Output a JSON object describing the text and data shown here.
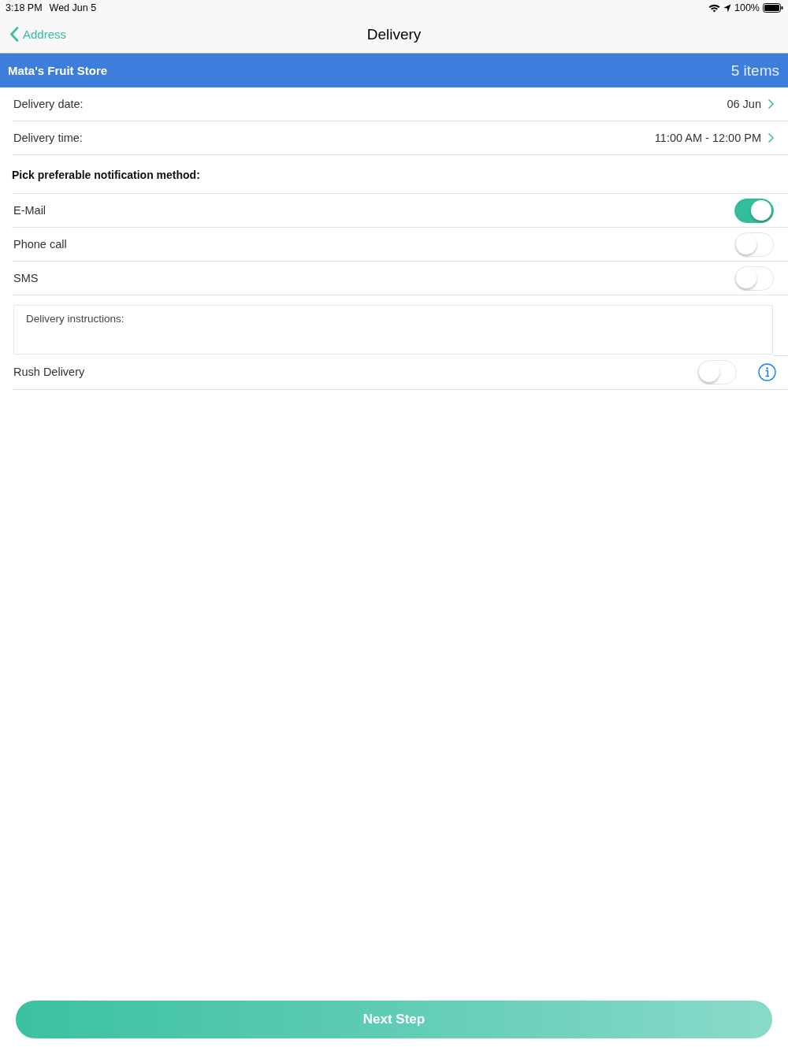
{
  "status_bar": {
    "time": "3:18 PM",
    "date": "Wed Jun 5",
    "battery": "100%"
  },
  "nav_bar": {
    "back_label": "Address",
    "title": "Delivery"
  },
  "store_header": {
    "name": "Mata's Fruit Store",
    "item_count": "5 items"
  },
  "schedule_rows": [
    {
      "label": "Delivery date:",
      "value": "06 Jun"
    },
    {
      "label": "Delivery time:",
      "value": "11:00 AM - 12:00 PM"
    }
  ],
  "notification": {
    "heading": "Pick preferable notification method:",
    "options": [
      {
        "label": "E-Mail",
        "on": true
      },
      {
        "label": "Phone call",
        "on": false
      },
      {
        "label": "SMS",
        "on": false
      }
    ]
  },
  "instructions": {
    "placeholder": "Delivery instructions:"
  },
  "rush_delivery": {
    "label": "Rush Delivery",
    "on": false
  },
  "next_button": {
    "label": "Next Step"
  }
}
